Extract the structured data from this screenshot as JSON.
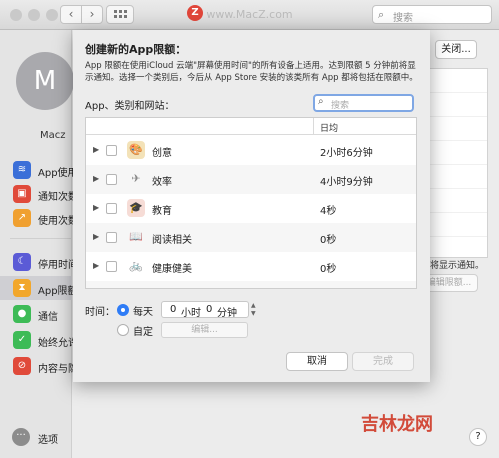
{
  "window": {
    "title": "www.MacZ.com",
    "search_placeholder": "搜索",
    "logo_letter": "Z"
  },
  "sidebar": {
    "avatar_letter": "M",
    "user_name": "Macz",
    "items": [
      {
        "label": "App使用",
        "icon": "layers-icon",
        "color": "#3b6fd8"
      },
      {
        "label": "通知次数",
        "icon": "notification-icon",
        "color": "#e04a3a"
      },
      {
        "label": "使用次数",
        "icon": "pickup-icon",
        "color": "#f0a030"
      },
      {
        "label": "停用时间",
        "icon": "downtime-moon-icon",
        "color": "#5b5bd6"
      },
      {
        "label": "App限额",
        "icon": "hourglass-icon",
        "color": "#f2a72c"
      },
      {
        "label": "通信",
        "icon": "person-icon",
        "color": "#3dbb56"
      },
      {
        "label": "始终允许",
        "icon": "checkmark-icon",
        "color": "#3dbb56"
      },
      {
        "label": "内容与隐私",
        "icon": "no-entry-icon",
        "color": "#e04a3a"
      }
    ],
    "options_label": "选项"
  },
  "background_right": {
    "close_label": "关闭...",
    "note_text": "将显示通知。",
    "edit_label": "编辑限额...",
    "help_label": "?"
  },
  "watermark": "吉林龙网",
  "sheet": {
    "title": "创建新的App限额：",
    "description_lines": [
      "App 限额在使用iCloud 云端\"屏幕使用时间\"的所有设备上适用。达到限额 5 分钟前将显",
      "示通知。选择一个类别后，今后从 App Store 安装的该类所有 App 都将包括在限额中。"
    ],
    "list_label": "App、类别和网站：",
    "search_placeholder": "搜索",
    "table": {
      "column_avg": "日均",
      "rows": [
        {
          "name": "创意",
          "avg": "2小时6分钟",
          "icon": "palette-icon",
          "glyph": "🎨"
        },
        {
          "name": "效率",
          "avg": "4小时9分钟",
          "icon": "paper-plane-icon",
          "glyph": "✈"
        },
        {
          "name": "教育",
          "avg": "4秒",
          "icon": "education-icon",
          "glyph": "🎓"
        },
        {
          "name": "阅读相关",
          "avg": "0秒",
          "icon": "book-icon",
          "glyph": "📖"
        },
        {
          "name": "健康健美",
          "avg": "0秒",
          "icon": "bicycle-icon",
          "glyph": "🚲"
        }
      ]
    },
    "time_label": "时间：",
    "daily_label": "每天",
    "hours_value": "0",
    "hours_unit": "小时",
    "minutes_value": "0",
    "minutes_unit": "分钟",
    "custom_label": "自定",
    "edit_label": "编辑...",
    "cancel_label": "取消",
    "done_label": "完成"
  }
}
